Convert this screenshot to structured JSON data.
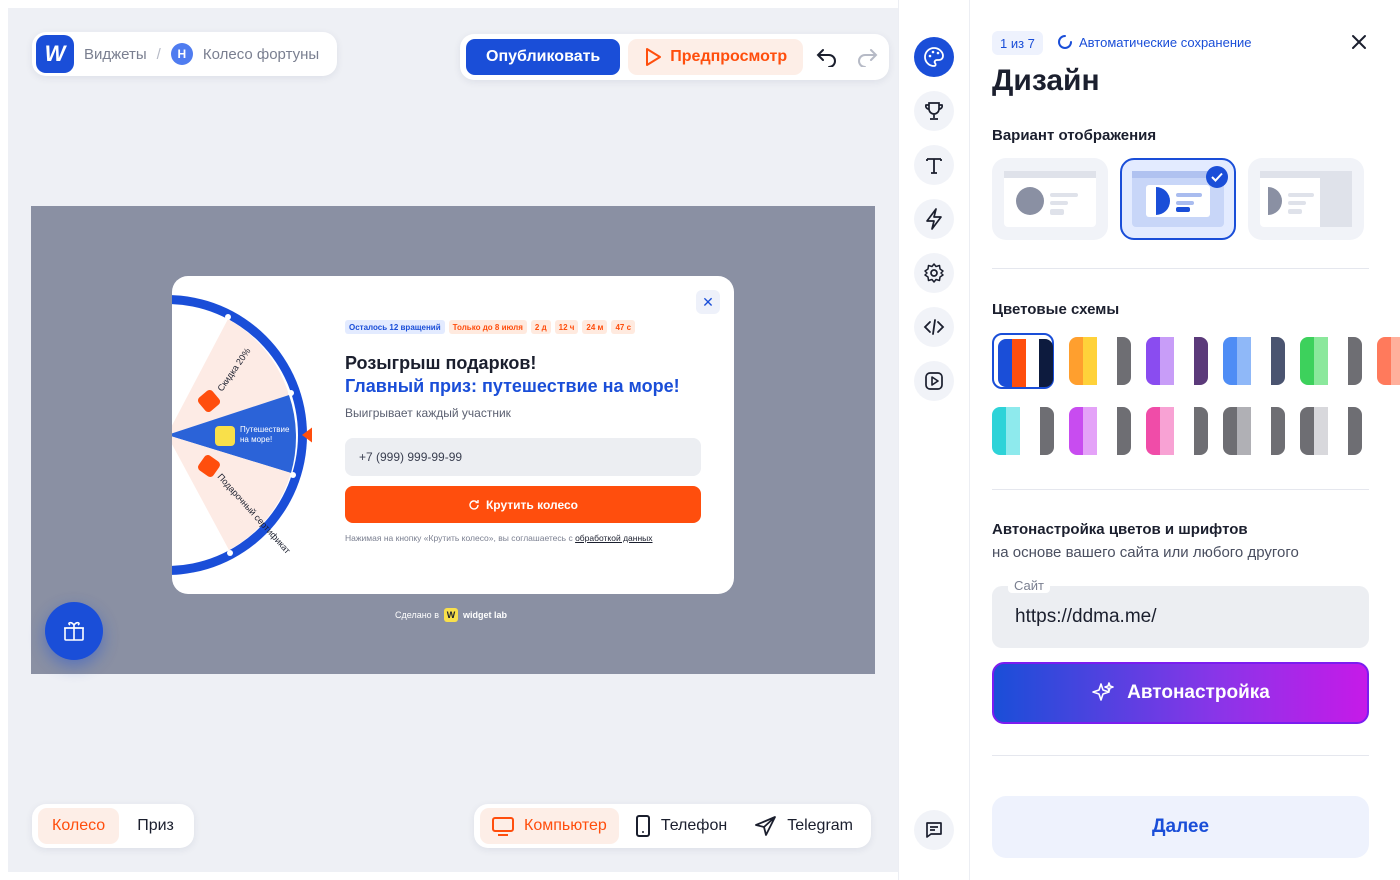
{
  "header": {
    "logo_letter": "W",
    "breadcrumb_1": "Виджеты",
    "breadcrumb_sep": "/",
    "breadcrumb_badge": "Н",
    "breadcrumb_2": "Колесо фортуны",
    "publish": "Опубликовать",
    "preview": "Предпросмотр"
  },
  "popup": {
    "tags": [
      "Осталось 12 вращений",
      "Только до 8 июля",
      "2 д",
      "12 ч",
      "24 м",
      "47 с"
    ],
    "title": "Розыгрыш подарков!",
    "title2": "Главный приз: путешествие на море!",
    "subtitle": "Выигрывает каждый участник",
    "phone_placeholder": "+7 (999) 999-99-99",
    "spin_button": "Крутить колесо",
    "agree_text": "Нажимая на кнопку «Крутить колесо», вы соглашаетесь с ",
    "agree_link": "обработкой данных",
    "wheel_sectors": [
      "Скидка 20%",
      "Путешествие на море!",
      "Подарочный сертификат"
    ],
    "close": "✕"
  },
  "footer_brand": {
    "made_in": "Сделано в",
    "logo_letter": "W",
    "brand": "widget lab"
  },
  "mode_tabs": [
    {
      "label": "Колесо",
      "active": true
    },
    {
      "label": "Приз",
      "active": false
    }
  ],
  "devices": [
    {
      "label": "Компьютер",
      "icon": "monitor-icon",
      "active": true
    },
    {
      "label": "Телефон",
      "icon": "phone-icon",
      "active": false
    },
    {
      "label": "Telegram",
      "icon": "send-icon",
      "active": false
    }
  ],
  "rail": [
    "palette-icon",
    "trophy-icon",
    "text-icon",
    "lightning-icon",
    "gear-icon",
    "code-icon",
    "play-icon",
    "chat-icon"
  ],
  "panel": {
    "step": "1 из 7",
    "autosave": "Автоматические сохранение",
    "title": "Дизайн",
    "display_section": "Вариант отображения",
    "selected_variant": 1,
    "color_section": "Цветовые схемы",
    "auto_title": "Автонастройка цветов и шрифтов",
    "auto_subtitle": "на основе вашего сайта или любого другого",
    "site_label": "Сайт",
    "site_value": "https://ddma.me/",
    "auto_button": "Автонастройка",
    "next_button": "Далее"
  },
  "color_schemes": [
    [
      "#1a4ed8",
      "#ff4e0d",
      "#0d1b3e"
    ],
    [
      "#ff9f2e",
      "#ffd23a",
      "#6e6e73"
    ],
    [
      "#8a4cf0",
      "#c89df8",
      "#5b3a7a"
    ],
    [
      "#4f8df5",
      "#8fb8f8",
      "#4a5470"
    ],
    [
      "#3dd15c",
      "#8be89c",
      "#6e6e73"
    ],
    [
      "#ff7a5c",
      "#ffb09c",
      "#6e6e73"
    ],
    [
      "#2ed3d8",
      "#8eeaed",
      "#6e6e73"
    ],
    [
      "#c84cf0",
      "#e4a2f8",
      "#6e6e73"
    ],
    [
      "#f04ca8",
      "#f8a2d4",
      "#6e6e73"
    ],
    [
      "#6e6e73",
      "#b0b0b5",
      "#6e6e73"
    ],
    [
      "#6e6e73",
      "#d8d8dc",
      "#6e6e73"
    ]
  ],
  "colors": {
    "brand": "#1a4ed8",
    "accent": "#ff4e0d"
  }
}
